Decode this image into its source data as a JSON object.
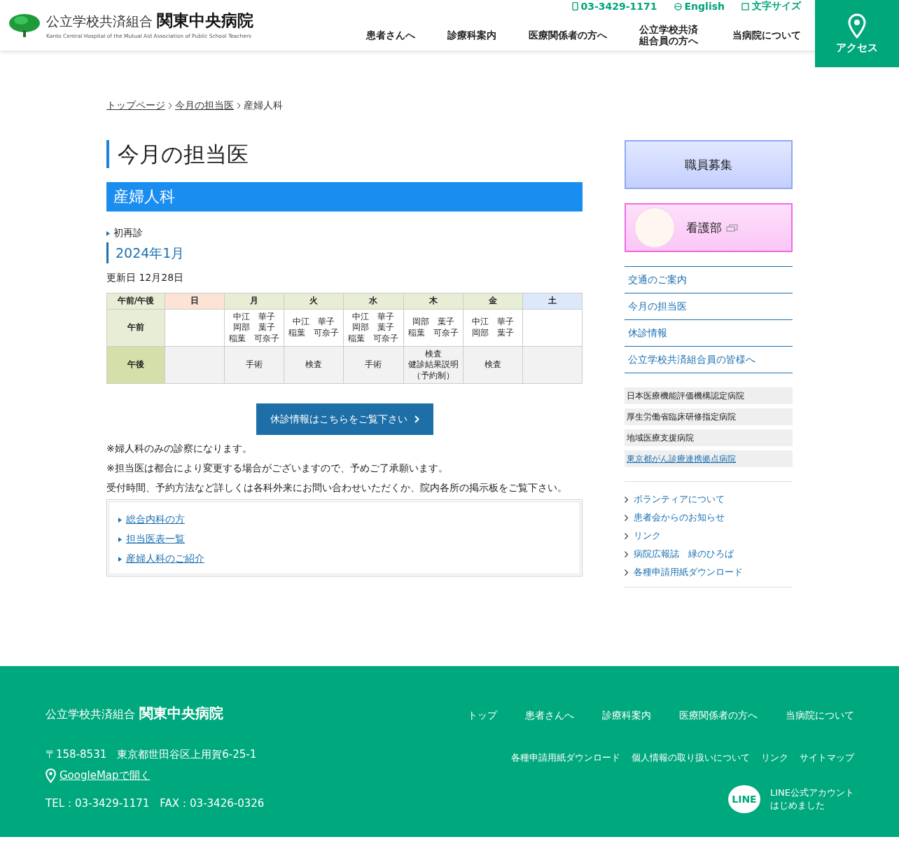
{
  "header": {
    "logo_sub": "公立学校共済組合",
    "logo_main": "関東中央病院",
    "logo_en": "Kanto Central Hospital of the Mutual Aid Association of Public School Teachers",
    "utility_links": [
      {
        "kind": "phone",
        "label": "03-3429-1171"
      },
      {
        "kind": "globe",
        "label": "English"
      },
      {
        "kind": "text",
        "label": "文字サイズ"
      }
    ],
    "nav": [
      "患者さんへ",
      "診療科案内",
      "医療関係者の方へ",
      "公立学校共済組合員の方へ",
      "当病院について"
    ],
    "access": "アクセス"
  },
  "breadcrumb": [
    {
      "label": "トップページ",
      "link": true
    },
    {
      "label": "今月の担当医",
      "link": true
    },
    {
      "label": "産婦人科",
      "link": false
    }
  ],
  "page_title": "今月の担当医",
  "section_title": "産婦人科",
  "subsection": "初再診",
  "month_title": "2024年1月",
  "updated": "更新日  12月28日",
  "table": {
    "corner": "午前/午後",
    "days": [
      {
        "label": "日",
        "color": "#fde3d4"
      },
      {
        "label": "月",
        "color": "#e8eed6"
      },
      {
        "label": "火",
        "color": "#e8eed6"
      },
      {
        "label": "水",
        "color": "#e8eed6"
      },
      {
        "label": "木",
        "color": "#e8eed6"
      },
      {
        "label": "金",
        "color": "#e8eed6"
      },
      {
        "label": "土",
        "color": "#dde9fa"
      }
    ],
    "rows": [
      {
        "label": "午前",
        "color": "#e8eed6",
        "cells": [
          null,
          [
            "中江　華子",
            "岡部　葉子",
            "稲葉　可奈子"
          ],
          [
            "中江　華子",
            "稲葉　可奈子"
          ],
          [
            "中江　華子",
            "岡部　葉子",
            "稲葉　可奈子"
          ],
          [
            "岡部　葉子",
            "稲葉　可奈子"
          ],
          [
            "中江　華子",
            "岡部　葉子"
          ],
          null
        ]
      },
      {
        "label": "午後",
        "color": "#d5dfa9",
        "cells": [
          null,
          [
            "手術"
          ],
          [
            "検査"
          ],
          [
            "手術"
          ],
          [
            "検査",
            "健診結果説明",
            "（予約制）"
          ],
          [
            "検査"
          ],
          null
        ]
      }
    ]
  },
  "button": "休診情報はこちらをご覧下さい",
  "notes": [
    "※婦人科のみの診察になります。",
    "※担当医は都合により変更する場合がございますので、予めご了承願います。",
    "受付時間、予約方法など詳しくは各科外来にお問い合わせいただくか、院内各所の掲示板をご覧下さい。"
  ],
  "related_links": [
    "総合内科の方",
    "担当医表一覧",
    "産婦人科のご紹介"
  ],
  "sidebar": {
    "recruit": "職員募集",
    "nursing": "看護部",
    "nav": [
      "交通のご案内",
      "今月の担当医",
      "休診情報",
      "公立学校共済組合員の皆様へ"
    ],
    "certifications": [
      {
        "label": "日本医療機能評価機構認定病院",
        "link": false
      },
      {
        "label": "厚生労働省臨床研修指定病院",
        "link": false
      },
      {
        "label": "地域医療支援病院",
        "link": false
      },
      {
        "label": "東京都がん診療連携拠点病院",
        "link": true
      }
    ],
    "links": [
      "ボランティアについて",
      "患者会からのお知らせ",
      "リンク",
      "病院広報誌　緑のひろば",
      "各種申請用紙ダウンロード"
    ]
  },
  "footer": {
    "logo_sub": "公立学校共済組合",
    "logo_main": "関東中央病院",
    "address": "〒158-8531　東京都世田谷区上用賀6-25-1",
    "map_link": "GoogleMapで開く",
    "tel_fax": "TEL：03-3429-1171　FAX：03-3426-0326",
    "nav": [
      "トップ",
      "患者さんへ",
      "診療科案内",
      "医療関係者の方へ",
      "当病院について"
    ],
    "subnav": [
      "各種申請用紙ダウンロード",
      "個人情報の取り扱いについて",
      "リンク",
      "サイトマップ"
    ],
    "line_logo": "LINE",
    "line_text": [
      "LINE公式アカウント",
      "はじめました"
    ]
  }
}
